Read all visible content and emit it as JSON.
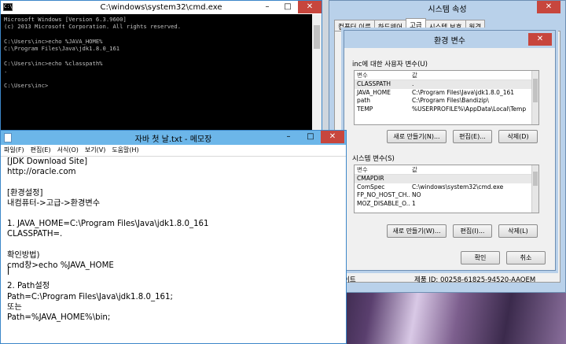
{
  "cmd": {
    "title": "C:\\windows\\system32\\cmd.exe",
    "icon": "C:\\",
    "lines": [
      "Microsoft Windows [Version 6.3.9600]",
      "(c) 2013 Microsoft Corporation. All rights reserved.",
      "",
      "C:\\Users\\inc>echo %JAVA_HOME%",
      "C:\\Program Files\\Java\\jdk1.8.0_161",
      "",
      "C:\\Users\\inc>echo %classpath%",
      ".",
      "",
      "C:\\Users\\inc>"
    ],
    "min": "–",
    "max": "□",
    "close": "✕"
  },
  "sysprop": {
    "title": "시스템 속성",
    "tabs": [
      "컴퓨터 이름",
      "하드웨어",
      "고급",
      "시스템 보호",
      "원격"
    ],
    "footer_left": "이트",
    "product_id": "제품 ID: 00258-61825-94520-AAOEM",
    "close": "✕"
  },
  "env": {
    "title": "환경 변수",
    "close": "✕",
    "user_group": "inc에 대한 사용자 변수(U)",
    "sys_group": "시스템 변수(S)",
    "col_var": "변수",
    "col_val": "값",
    "user_vars": [
      {
        "name": "CLASSPATH",
        "value": "."
      },
      {
        "name": "JAVA_HOME",
        "value": "C:\\Program Files\\Java\\jdk1.8.0_161"
      },
      {
        "name": "path",
        "value": "C:\\Program Files\\Bandizip\\"
      },
      {
        "name": "TEMP",
        "value": "%USERPROFILE%\\AppData\\Local\\Temp"
      }
    ],
    "sys_vars": [
      {
        "name": "CMAPDIR",
        "value": ""
      },
      {
        "name": "ComSpec",
        "value": "C:\\windows\\system32\\cmd.exe"
      },
      {
        "name": "FP_NO_HOST_CH...",
        "value": "NO"
      },
      {
        "name": "MOZ_DISABLE_O...",
        "value": "1"
      }
    ],
    "btn_new_user": "새로 만들기(N)...",
    "btn_edit_user": "편집(E)...",
    "btn_del_user": "삭제(D)",
    "btn_new_sys": "새로 만들기(W)...",
    "btn_edit_sys": "편집(I)...",
    "btn_del_sys": "삭제(L)",
    "btn_ok": "확인",
    "btn_cancel": "취소"
  },
  "notepad": {
    "title": "자바 첫 날.txt - 메모장",
    "menu": [
      "파일(F)",
      "편집(E)",
      "서식(O)",
      "보기(V)",
      "도움말(H)"
    ],
    "text": "[JDK Download Site]\nhttp://oracle.com\n\n[환경설정]\n내컴퓨터->고급->환경변수\n\n1. JAVA_HOME=C:\\Program Files\\Java\\jdk1.8.0_161\nCLASSPATH=.\n\n확인방법)\ncmd창>echo %JAVA_HOME\n\n2. Path설정\nPath=C:\\Program Files\\Java\\jdk1.8.0_161;\n또는\nPath=%JAVA_HOME%\\bin;",
    "min": "–",
    "max": "□",
    "close": "✕"
  }
}
